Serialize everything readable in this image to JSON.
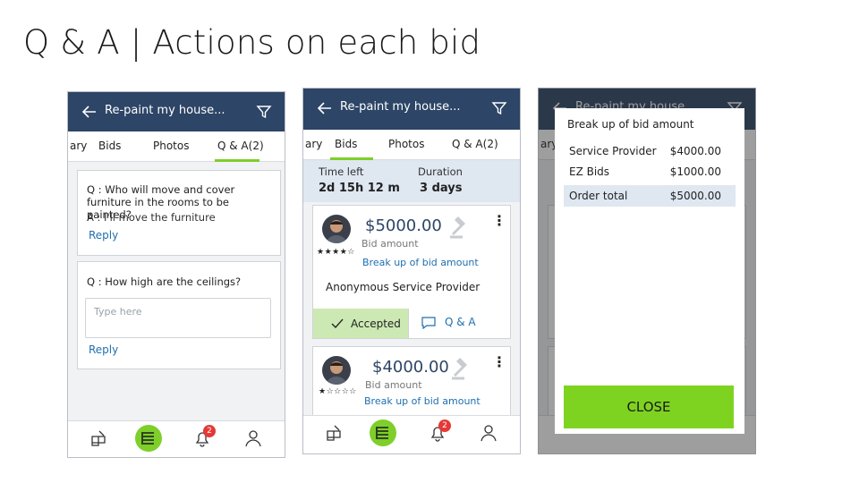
{
  "slide": {
    "title": "Q & A | Actions on each bid"
  },
  "colors": {
    "appbar": "#2d4566",
    "accent_green": "#7ecf2a",
    "link": "#1f6fb0",
    "badge": "#e53935",
    "close_button": "#7ed321"
  },
  "app": {
    "title": "Re-paint my house..."
  },
  "phone1": {
    "tabs": [
      "ary",
      "Bids",
      "Photos",
      "Q & A(2)"
    ],
    "active_tab": "Q & A(2)",
    "questions": [
      {
        "q": "Q : Who will move and cover furniture in the rooms to be painted?",
        "a": "A : I'll move the furniture",
        "reply": "Reply"
      },
      {
        "q": "Q : How high are the ceilings?",
        "placeholder": "Type here",
        "reply": "Reply"
      }
    ],
    "badge_count": "2"
  },
  "phone2": {
    "tabs": [
      "ary",
      "Bids",
      "Photos",
      "Q & A(2)"
    ],
    "active_tab": "Bids",
    "time_left_label": "Time left",
    "time_left_value": "2d 15h 12 m",
    "duration_label": "Duration",
    "duration_value": "3 days",
    "bids": [
      {
        "amount": "$5000.00",
        "amount_label": "Bid amount",
        "stars": "★★★★☆",
        "rating": 4,
        "breakup": "Break up of bid amount",
        "provider": "Anonymous Service Provider",
        "accepted_label": "Accepted",
        "qa_label": "Q & A"
      },
      {
        "amount": "$4000.00",
        "amount_label": "Bid amount",
        "stars": "★☆☆☆☆",
        "rating": 1,
        "breakup": "Break up of bid amount"
      }
    ],
    "badge_count": "2"
  },
  "phone3": {
    "modal_title": "Break up of bid amount",
    "rows": [
      {
        "label": "Service Provider",
        "value": "$4000.00"
      },
      {
        "label": "EZ Bids",
        "value": "$1000.00"
      }
    ],
    "total": {
      "label": "Order total",
      "value": "$5000.00"
    },
    "close_label": "CLOSE",
    "behind_tab": "ary"
  }
}
